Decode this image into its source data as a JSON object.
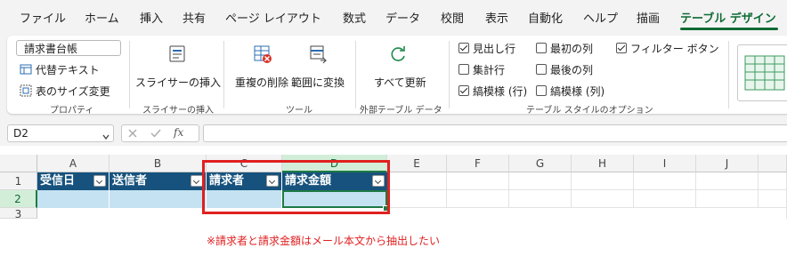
{
  "ribbon_tabs": [
    "ファイル",
    "ホーム",
    "挿入",
    "共有",
    "ページ レイアウト",
    "数式",
    "データ",
    "校閲",
    "表示",
    "自動化",
    "ヘルプ",
    "描画",
    "テーブル デザイン"
  ],
  "properties": {
    "table_name": "請求書台帳",
    "convert_label": "代替テキスト",
    "resize_label": "表のサイズ変更",
    "group_label": "プロパティ"
  },
  "slicer": {
    "insert_label": "スライサーの挿入",
    "group_label": "スライサーの挿入"
  },
  "tools": {
    "remove_duplicates": "重複の削除",
    "convert_to_range": "範囲に変換",
    "group_label": "ツール"
  },
  "external": {
    "refresh_all": "すべて更新",
    "group_label": "外部テーブル データ"
  },
  "style_options": {
    "header_row": "見出し行",
    "total_row": "集計行",
    "banded_rows": "縞模様 (行)",
    "first_column": "最初の列",
    "last_column": "最後の列",
    "banded_columns": "縞模様 (列)",
    "filter_button": "フィルター ボタン",
    "group_label": "テーブル スタイルのオプション",
    "header_row_checked": true,
    "total_row_checked": false,
    "banded_rows_checked": true,
    "first_column_checked": false,
    "last_column_checked": false,
    "banded_columns_checked": false,
    "filter_button_checked": true
  },
  "formula_bar": {
    "name_box": "D2",
    "fx_label": "fx",
    "formula": ""
  },
  "columns": [
    "A",
    "B",
    "C",
    "D",
    "E",
    "F",
    "G",
    "H",
    "I",
    "J"
  ],
  "rows": [
    "1",
    "2",
    "3"
  ],
  "table_headers": [
    "受信日",
    "送信者",
    "請求者",
    "請求金額"
  ],
  "annotation": "※請求者と請求金額はメール本文から抽出したい",
  "colors": {
    "accent": "#0f6b35",
    "table_header": "#16527d",
    "table_band": "#c5e2f2",
    "highlight_box": "#e02020"
  }
}
